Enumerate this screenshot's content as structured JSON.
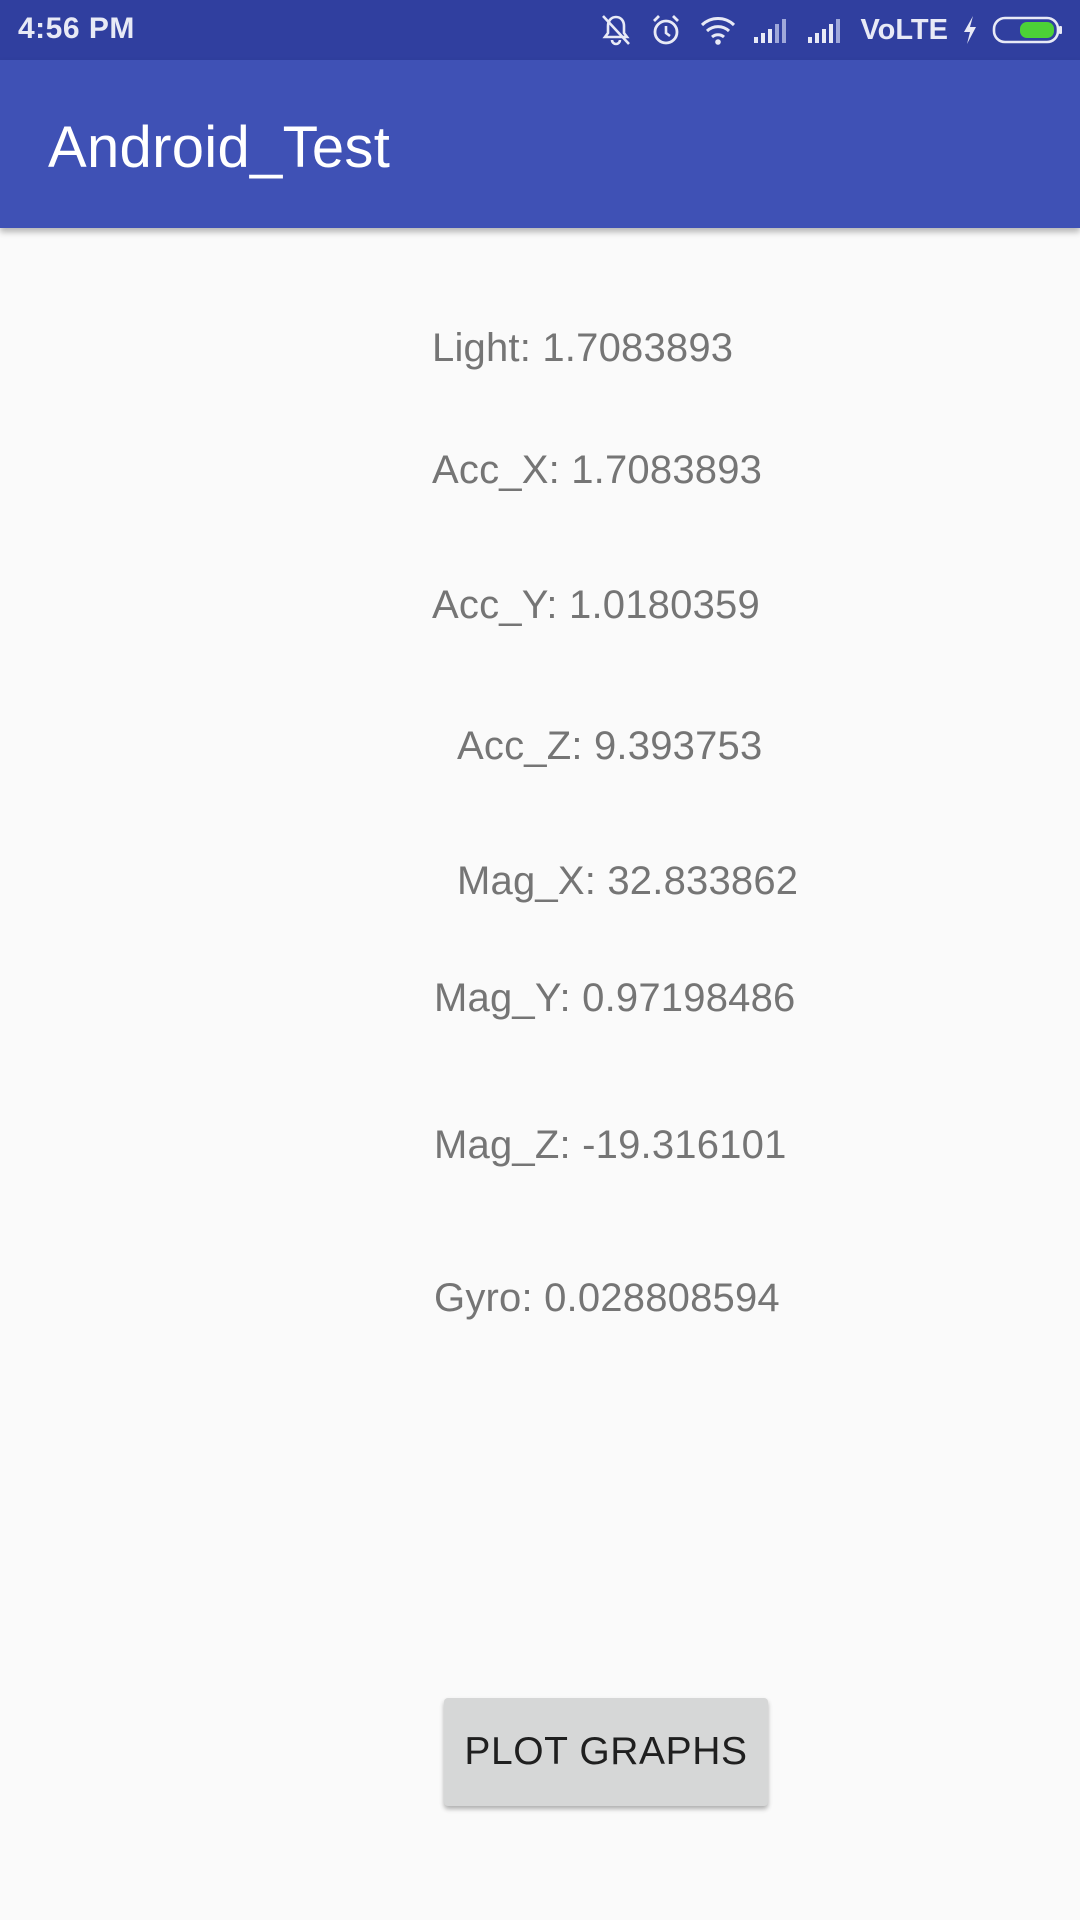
{
  "status_bar": {
    "time": "4:56 PM",
    "network_label": "VoLTE",
    "icons": [
      "mute-bell-icon",
      "alarm-icon",
      "wifi-icon",
      "signal-icon",
      "signal-icon",
      "charging-bolt-icon",
      "battery-icon"
    ],
    "battery_color": "#4cd137"
  },
  "app_bar": {
    "title": "Android_Test",
    "color": "#3f51b5",
    "status_color": "#303f9f"
  },
  "readings": {
    "light": "Light: 1.7083893",
    "acc_x": "Acc_X: 1.7083893",
    "acc_y": "Acc_Y: 1.0180359",
    "acc_z": "Acc_Z: 9.393753",
    "mag_x": "Mag_X: 32.833862",
    "mag_y": "Mag_Y: 0.97198486",
    "mag_z": "Mag_Z: -19.316101",
    "gyro": "Gyro: 0.028808594"
  },
  "buttons": {
    "plot_graphs": "PLOT GRAPHS"
  }
}
